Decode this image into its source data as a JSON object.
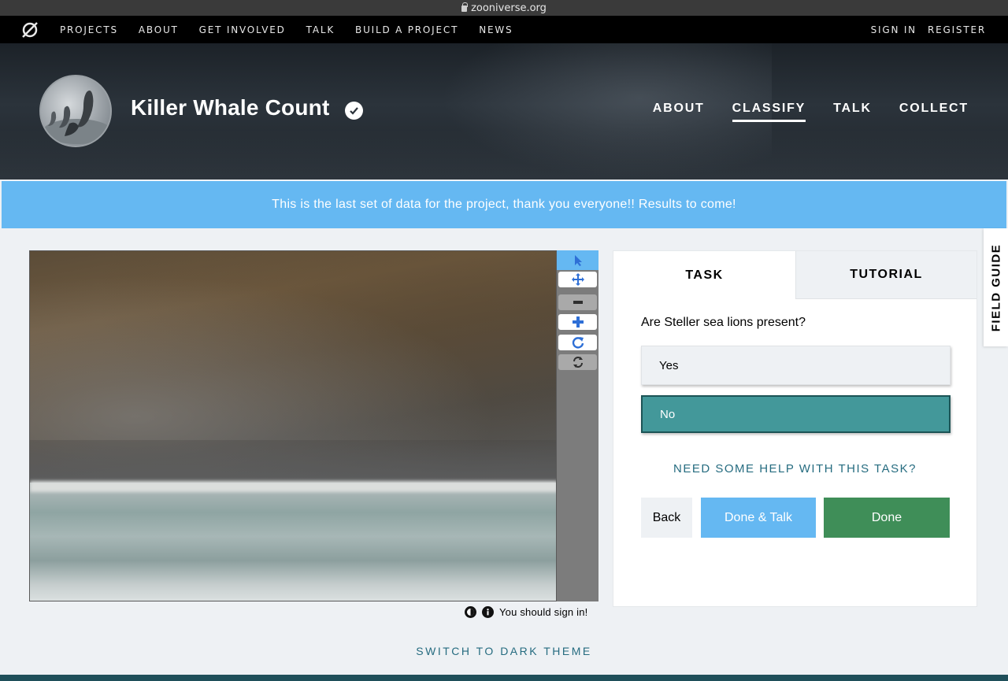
{
  "browser": {
    "url": "zooniverse.org"
  },
  "topnav": {
    "links": [
      "PROJECTS",
      "ABOUT",
      "GET INVOLVED",
      "TALK",
      "BUILD A PROJECT",
      "NEWS"
    ],
    "sign_in": "SIGN IN",
    "register": "REGISTER"
  },
  "project": {
    "title": "Killer Whale Count",
    "nav": [
      "ABOUT",
      "CLASSIFY",
      "TALK",
      "COLLECT"
    ],
    "active_nav": "CLASSIFY"
  },
  "announcement": "This is the last set of data for the project, thank you everyone!! Results to come!",
  "tools": [
    "pointer-icon",
    "move-icon",
    "zoom-out-icon",
    "zoom-in-icon",
    "rotate-icon",
    "reset-icon"
  ],
  "subject_footer": {
    "message": "You should sign in!"
  },
  "task": {
    "tabs": [
      "TASK",
      "TUTORIAL"
    ],
    "question": "Are Steller sea lions present?",
    "answers": [
      "Yes",
      "No"
    ],
    "selected_answer": "No",
    "help": "NEED SOME HELP WITH THIS TASK?",
    "back": "Back",
    "done_talk": "Done & Talk",
    "done": "Done"
  },
  "field_guide": "FIELD GUIDE",
  "theme_toggle": "SWITCH TO DARK THEME",
  "colors": {
    "accent_blue": "#65b8f2",
    "selected_teal": "#43989a",
    "done_green": "#3f8e58",
    "link_teal": "#266c80"
  }
}
